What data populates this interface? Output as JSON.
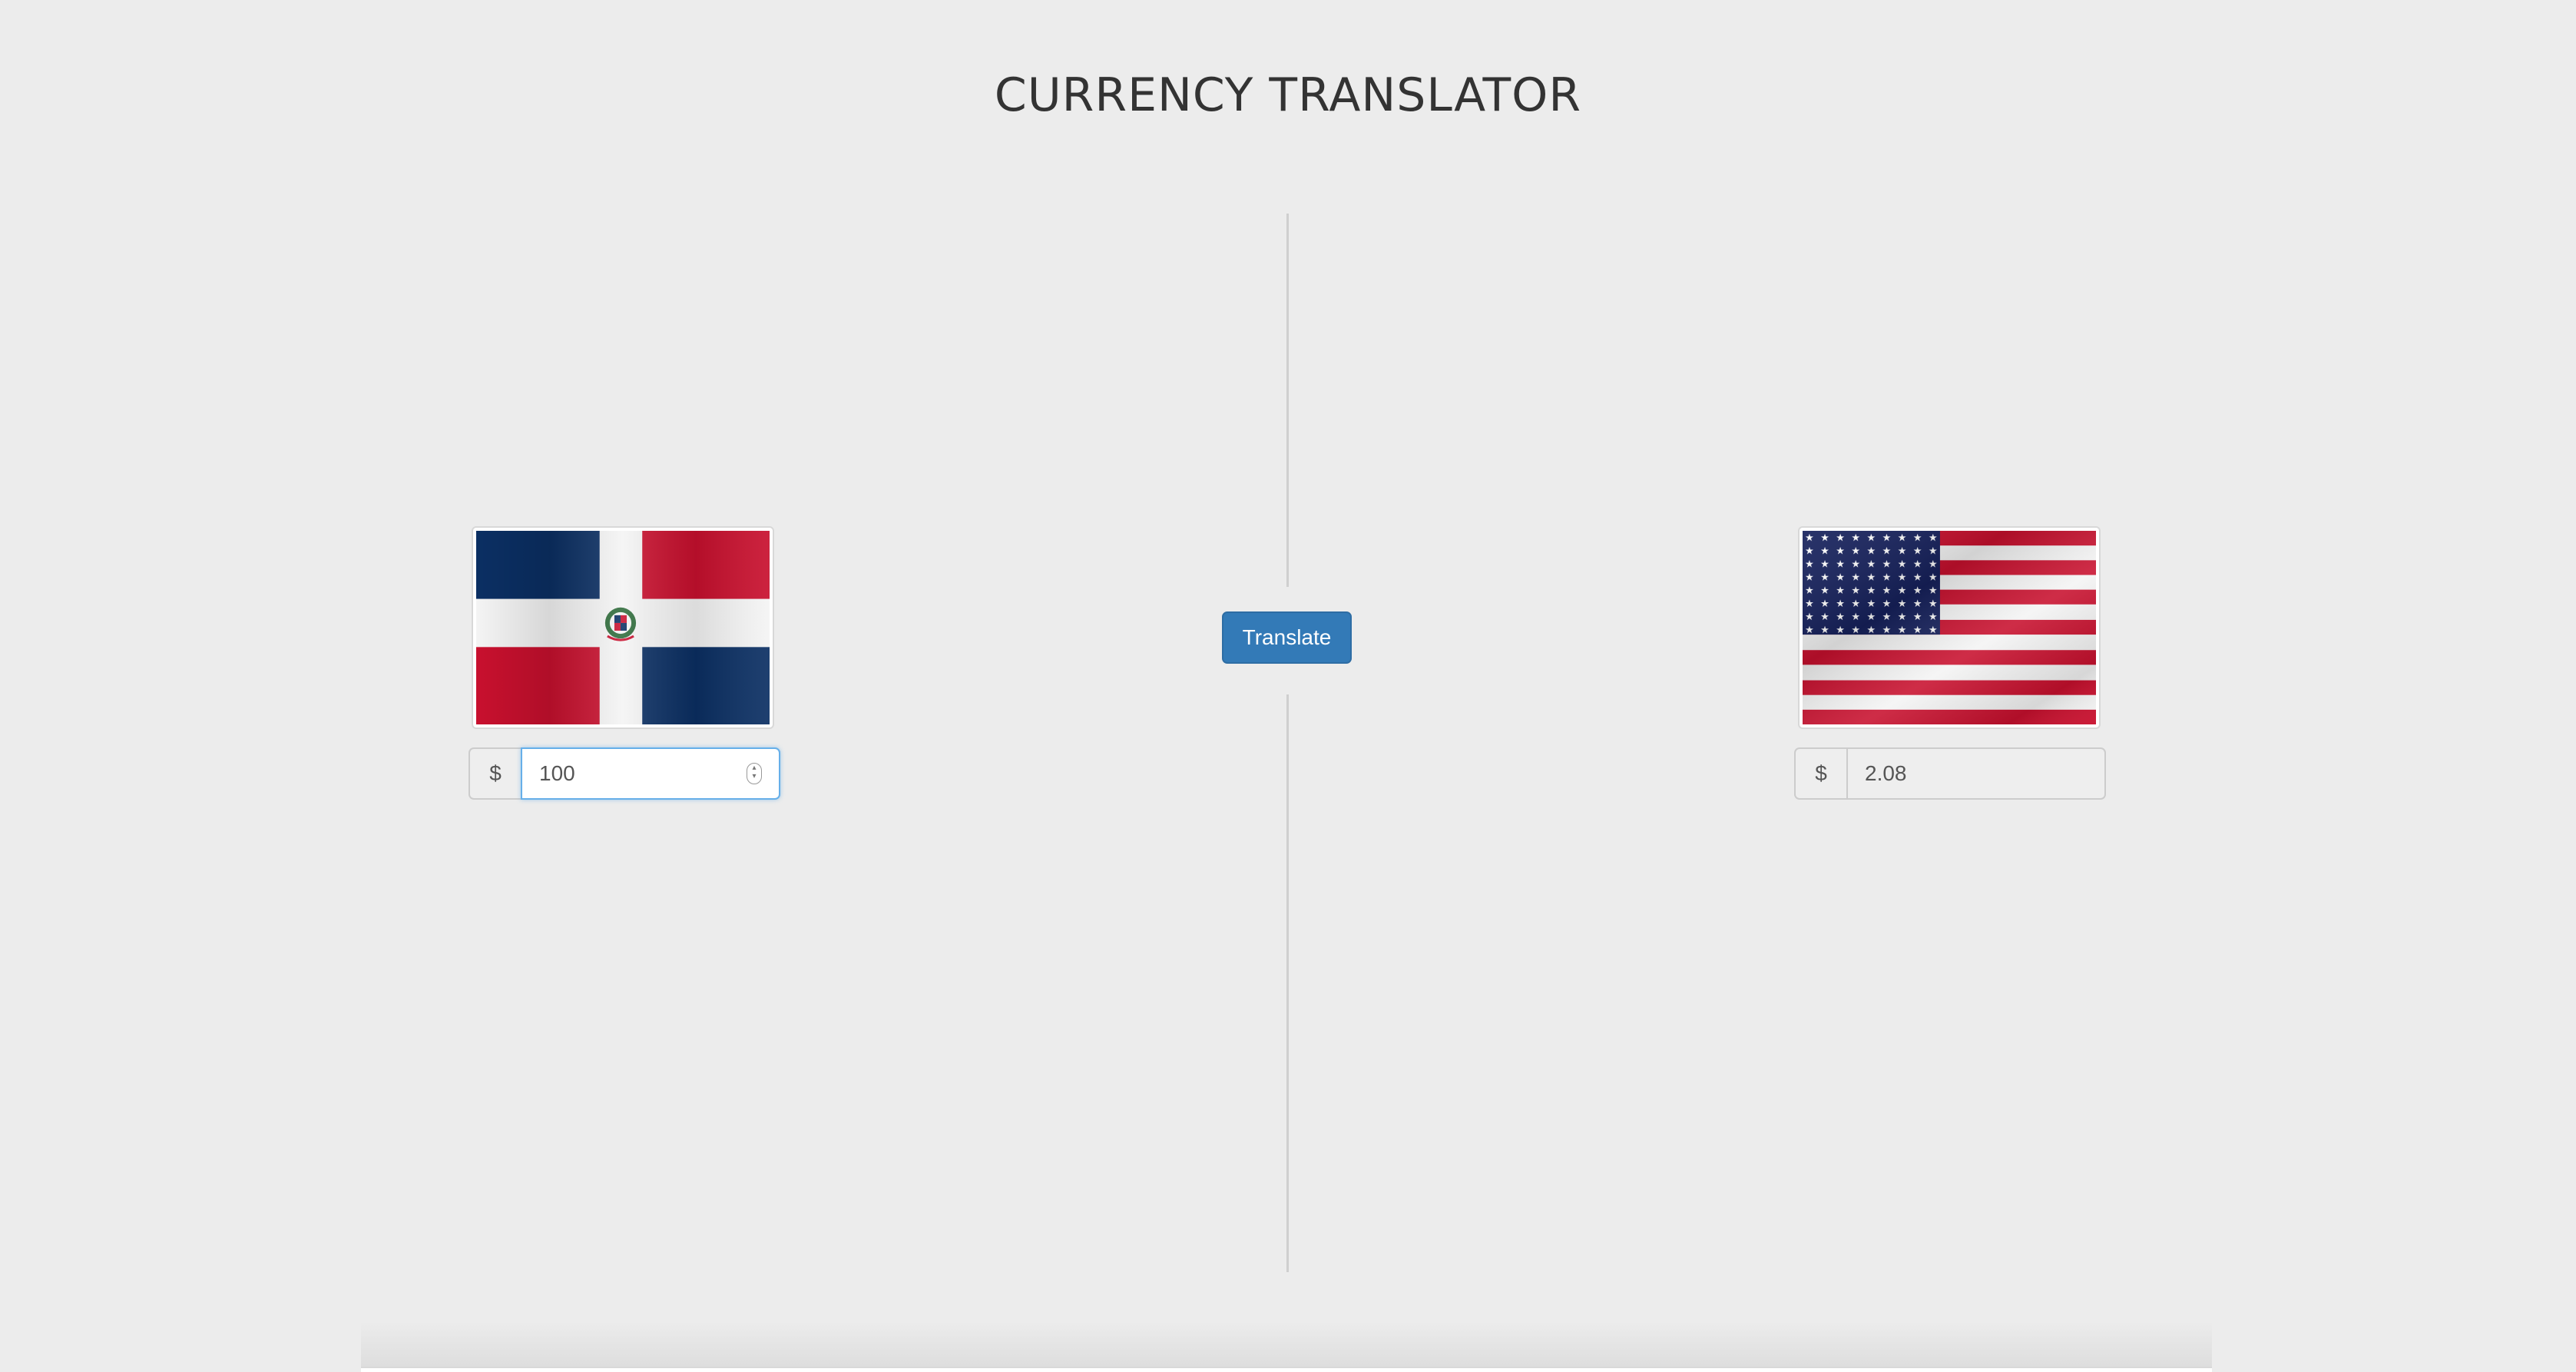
{
  "header": {
    "title": "CURRENCY TRANSLATOR"
  },
  "source": {
    "flag_icon": "dominican-republic-flag-icon",
    "currency_symbol": "$",
    "amount_value": "100"
  },
  "action": {
    "translate_label": "Translate"
  },
  "target": {
    "flag_icon": "united-states-flag-icon",
    "currency_symbol": "$",
    "result_value": "2.08"
  },
  "colors": {
    "background": "#ececec",
    "button": "#337ab7",
    "focus_border": "#66afe9"
  }
}
